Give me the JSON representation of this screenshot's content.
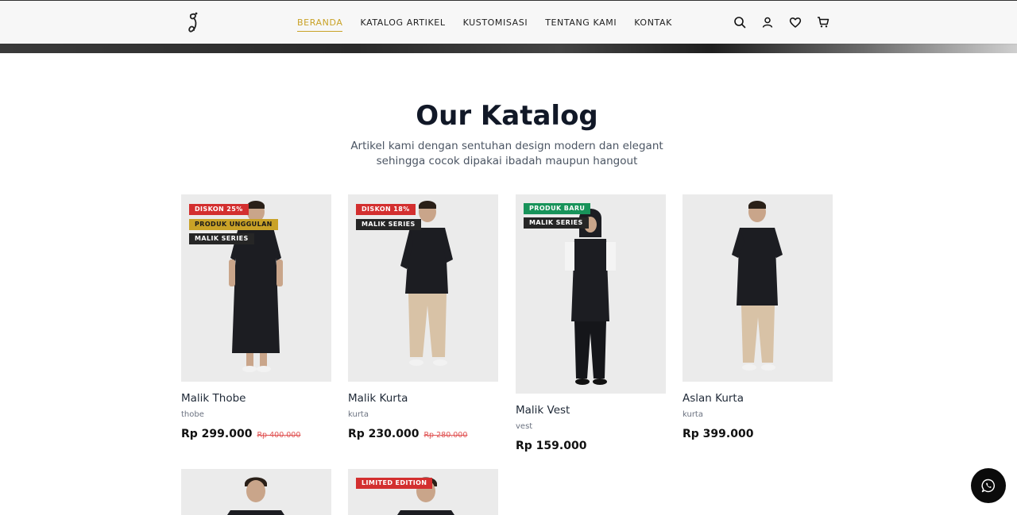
{
  "header": {
    "logo_name": "brand-logo",
    "nav": [
      {
        "label": "BERANDA",
        "active": true
      },
      {
        "label": "KATALOG ARTIKEL",
        "active": false
      },
      {
        "label": "KUSTOMISASI",
        "active": false
      },
      {
        "label": "TENTANG KAMI",
        "active": false
      },
      {
        "label": "KONTAK",
        "active": false
      }
    ],
    "icons": [
      "search-icon",
      "user-icon",
      "heart-icon",
      "cart-icon"
    ],
    "accent_color": "#c9a227"
  },
  "catalog": {
    "title": "Our Katalog",
    "subtitle": "Artikel kami dengan sentuhan design modern dan elegant sehingga cocok dipakai ibadah maupun hangout",
    "products": [
      {
        "name": "Malik Thobe",
        "category": "thobe",
        "price": "Rp 299.000",
        "old_price": "Rp 400.000",
        "badges": [
          {
            "text": "DISKON 25%",
            "color": "red"
          },
          {
            "text": "PRODUK UNGGULAN",
            "color": "gold"
          },
          {
            "text": "MALIK SERIES",
            "color": "dark"
          }
        ]
      },
      {
        "name": "Malik Kurta",
        "category": "kurta",
        "price": "Rp 230.000",
        "old_price": "Rp 280.000",
        "badges": [
          {
            "text": "DISKON 18%",
            "color": "red"
          },
          {
            "text": "MALIK SERIES",
            "color": "dark"
          }
        ]
      },
      {
        "name": "Malik Vest",
        "category": "vest",
        "price": "Rp 159.000",
        "old_price": "",
        "badges": [
          {
            "text": "PRODUK BARU",
            "color": "green"
          },
          {
            "text": "MALIK SERIES",
            "color": "dark"
          }
        ]
      },
      {
        "name": "Aslan Kurta",
        "category": "kurta",
        "price": "Rp 399.000",
        "old_price": "",
        "badges": []
      },
      {
        "name": "",
        "category": "",
        "price": "",
        "old_price": "",
        "badges": []
      },
      {
        "name": "",
        "category": "",
        "price": "",
        "old_price": "",
        "badges": [
          {
            "text": "LIMITED EDITION",
            "color": "red"
          }
        ]
      }
    ]
  },
  "floating": {
    "icon": "whatsapp-icon"
  }
}
